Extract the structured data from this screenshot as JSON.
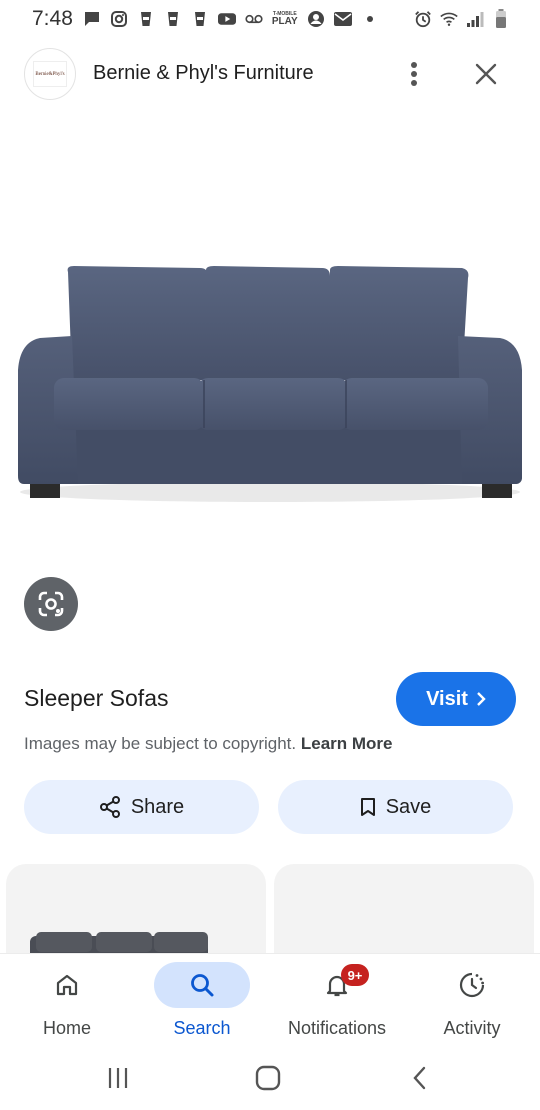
{
  "status_bar": {
    "time": "7:48",
    "left_icons": [
      "chat-bubble-icon",
      "instagram-icon",
      "cup-icon",
      "cup-icon",
      "cup-icon",
      "youtube-icon",
      "voicemail-icon",
      "tmobile-play-icon",
      "account-circle-icon",
      "mail-icon",
      "dot-icon"
    ],
    "tmobile_text_top": "T-MOBILE",
    "tmobile_text_bottom": "PLAY",
    "right_icons": [
      "alarm-icon",
      "wifi-icon",
      "signal-icon",
      "battery-icon"
    ]
  },
  "header": {
    "site_name": "Bernie & Phyl's Furniture",
    "logo_text": "Bernie&Phyl's"
  },
  "hero": {
    "alt": "sofa-image",
    "sofa_color": "#4a5670"
  },
  "result": {
    "title": "Sleeper Sofas",
    "visit_label": "Visit",
    "copyright_text": "Images may be subject to copyright.",
    "learn_more": "Learn More"
  },
  "actions": {
    "share_label": "Share",
    "save_label": "Save"
  },
  "bottom_nav": {
    "items": [
      {
        "label": "Home",
        "icon": "home-icon",
        "active": false
      },
      {
        "label": "Search",
        "icon": "search-icon",
        "active": true
      },
      {
        "label": "Notifications",
        "icon": "bell-icon",
        "active": false,
        "badge": "9+"
      },
      {
        "label": "Activity",
        "icon": "activity-icon",
        "active": false
      }
    ]
  },
  "colors": {
    "accent": "#1a73e8",
    "pill_bg": "#e8f0fe",
    "badge": "#c5221f",
    "active_nav": "#0b57d0"
  }
}
